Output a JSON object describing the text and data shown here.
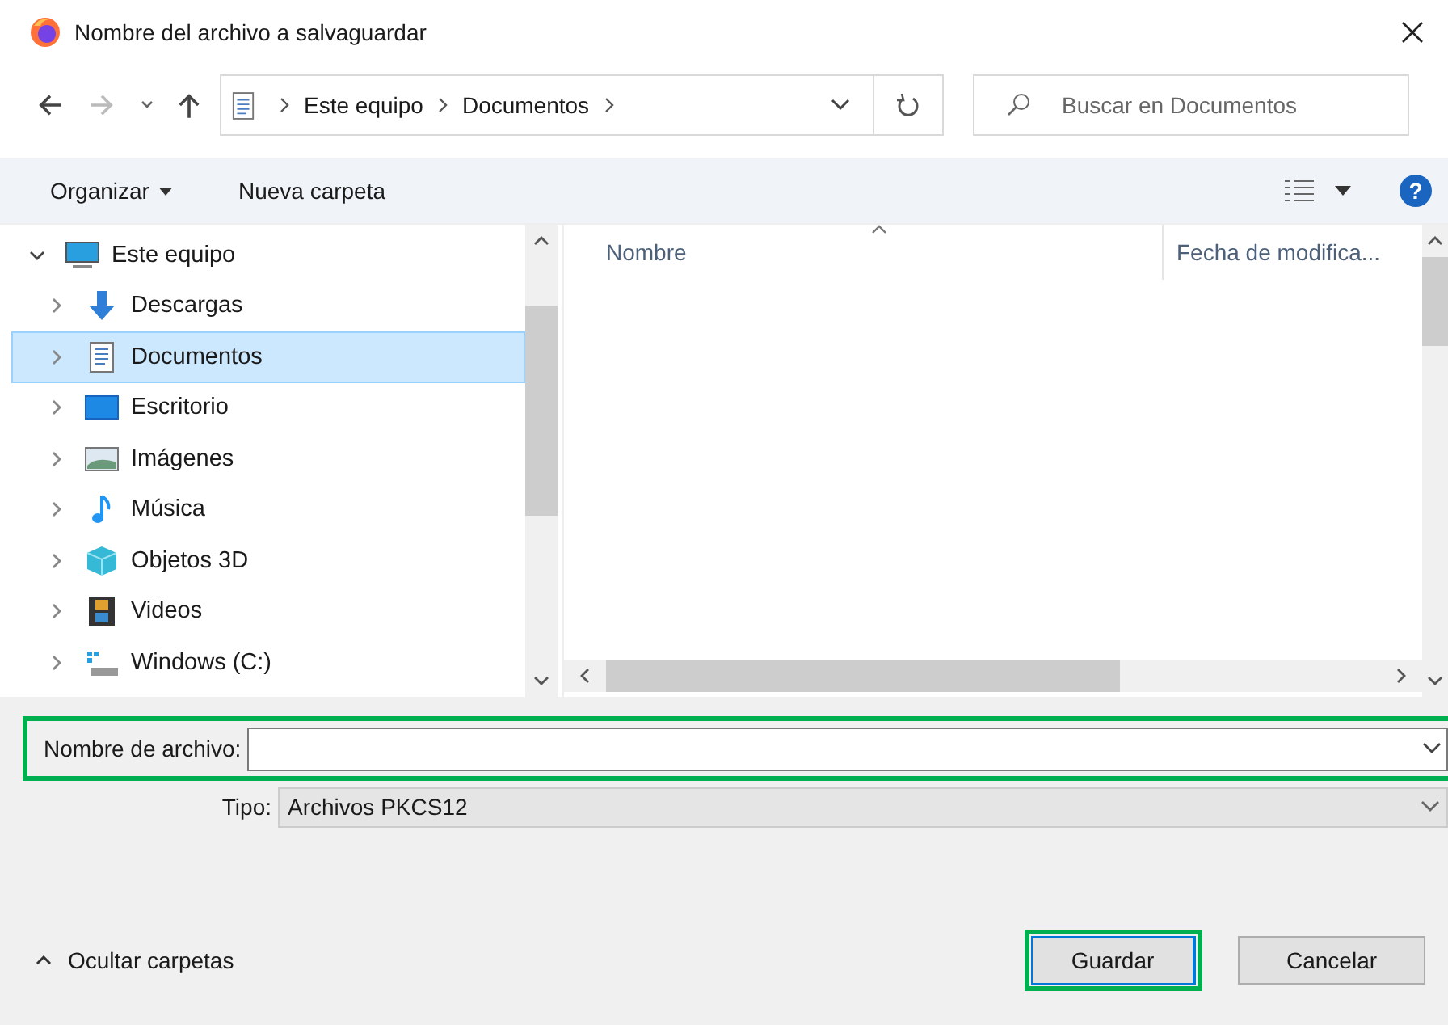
{
  "window": {
    "title": "Nombre del archivo a salvaguardar"
  },
  "address": {
    "segments": [
      "Este equipo",
      "Documentos"
    ]
  },
  "search": {
    "placeholder": "Buscar en Documentos"
  },
  "toolbar": {
    "organize": "Organizar",
    "new_folder": "Nueva carpeta",
    "help": "?"
  },
  "tree": [
    {
      "label": "Este equipo",
      "kind": "computer",
      "expanded": true,
      "selected": false,
      "children": [
        {
          "label": "Descargas",
          "kind": "download",
          "expanded": false,
          "selected": false
        },
        {
          "label": "Documentos",
          "kind": "document",
          "expanded": false,
          "selected": true
        },
        {
          "label": "Escritorio",
          "kind": "desktop",
          "expanded": false,
          "selected": false
        },
        {
          "label": "Imágenes",
          "kind": "pictures",
          "expanded": false,
          "selected": false
        },
        {
          "label": "Música",
          "kind": "music",
          "expanded": false,
          "selected": false
        },
        {
          "label": "Objetos 3D",
          "kind": "cube",
          "expanded": false,
          "selected": false
        },
        {
          "label": "Videos",
          "kind": "video",
          "expanded": false,
          "selected": false
        },
        {
          "label": "Windows (C:)",
          "kind": "drive",
          "expanded": false,
          "selected": false
        }
      ]
    }
  ],
  "file_list": {
    "columns": [
      "Nombre",
      "Fecha de modifica..."
    ]
  },
  "form": {
    "filename_label": "Nombre de archivo:",
    "type_label": "Tipo:",
    "type_value": "Archivos PKCS12"
  },
  "footer": {
    "hide_folders": "Ocultar carpetas",
    "buttons": [
      "Guardar",
      "Cancelar"
    ]
  }
}
